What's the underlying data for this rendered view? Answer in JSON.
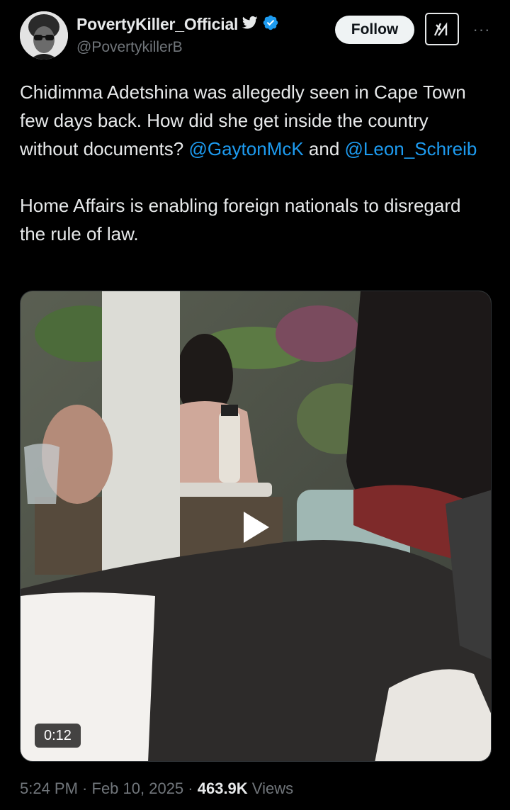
{
  "author": {
    "display_name": "PovertyKiller_Official",
    "handle": "@PovertykillerB"
  },
  "header": {
    "follow_label": "Follow",
    "more_label": "···"
  },
  "tweet": {
    "line1_text": "Chidimma Adetshina was allegedly seen in Cape Town few days back. How did she get inside the country without documents? ",
    "mention1": "@GaytonMcK",
    "and_text": " and ",
    "mention2": "@Leon_Schreib",
    "paragraph2": "Home Affairs is enabling foreign nationals to disregard the rule of law."
  },
  "media": {
    "duration": "0:12"
  },
  "meta": {
    "time": "5:24 PM",
    "sep1": " · ",
    "date": "Feb 10, 2025",
    "sep2": " · ",
    "views_count": "463.9K",
    "views_label": " Views"
  },
  "colors": {
    "background": "#000000",
    "text": "#e7e9ea",
    "muted": "#71767b",
    "link": "#1d9bf0",
    "verified": "#1d9bf0"
  }
}
